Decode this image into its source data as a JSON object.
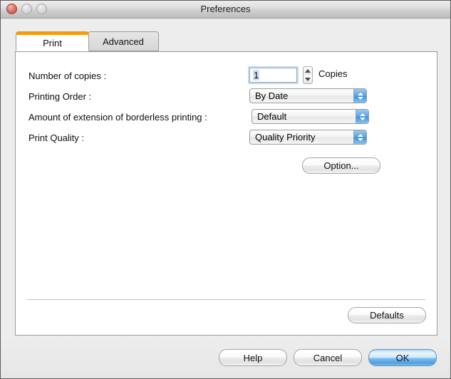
{
  "window": {
    "title": "Preferences",
    "controls": {
      "close": "close-button",
      "minimize": "minimize-button",
      "zoom": "zoom-button"
    }
  },
  "tabs": [
    {
      "label": "Print",
      "active": true
    },
    {
      "label": "Advanced",
      "active": false
    }
  ],
  "form": {
    "copies": {
      "label": "Number of copies :",
      "value": "1",
      "suffix": "Copies"
    },
    "printing_order": {
      "label": "Printing Order :",
      "value": "By Date"
    },
    "borderless_extension": {
      "label": "Amount of extension of borderless printing :",
      "value": "Default"
    },
    "print_quality": {
      "label": "Print Quality :",
      "value": "Quality Priority"
    }
  },
  "buttons": {
    "option": "Option...",
    "defaults": "Defaults",
    "help": "Help",
    "cancel": "Cancel",
    "ok": "OK"
  },
  "colors": {
    "active_tab_accent": "#f59a0c",
    "default_button_blue": "#4e9fe2",
    "popup_arrow_blue": "#3d93dc",
    "focus_ring": "#96beeb"
  }
}
